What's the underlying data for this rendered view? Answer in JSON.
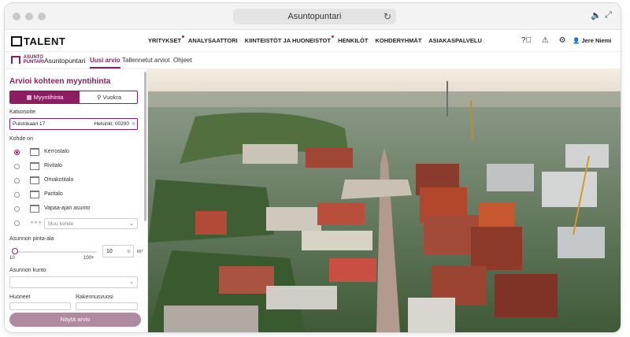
{
  "browser": {
    "url_title": "Asuntopuntari",
    "reload_icon": "reload-icon",
    "audio_icon": "speaker-icon",
    "expand_icon": "expand-icon"
  },
  "topnav": {
    "logo_text": "TALENT",
    "links": [
      "YRITYKSET",
      "ANALYSAATTORI",
      "KIINTEISTÖT JA HUONEISTOT",
      "HENKILÖT",
      "KOHDERYHMÄT",
      "ASIAKASPALVELU"
    ],
    "icons": [
      "help-icon",
      "warning-icon",
      "gear-icon",
      "user-icon"
    ],
    "user_name": "Jere Niemi"
  },
  "subnav": {
    "brand_line1": "ASUNTO",
    "brand_line2": "PUNTARI",
    "app_name": "Asuntopuntari",
    "tabs": [
      "Uusi arvio",
      "Tallennetut arviot",
      "Ohjeet"
    ],
    "active_tab": "Uusi arvio"
  },
  "form": {
    "title": "Arvioi kohteen myyntihinta",
    "toggle_sale": "Myyntihinta",
    "toggle_rent": "Vuokra",
    "address_label": "Katuosoite",
    "address_value": "Puistokaari 17",
    "address_city": "Helsinki, 00200",
    "type_label": "Kohde on",
    "types": [
      "Kerrostalo",
      "Rivitalo",
      "Omakotitalo",
      "Paritalo",
      "Vapaa-ajan asunto"
    ],
    "selected_type": "Kerrostalo",
    "other_type_placeholder": "Muu kohde",
    "area_label": "Asunnon pinta-ala",
    "area_min": "10",
    "area_max": "100+",
    "area_value": "10",
    "area_unit": "m²",
    "slider_level": 0,
    "condition_label": "Asunnon kunto",
    "rooms_label": "Huoneet",
    "year_label": "Rakennusvuosi",
    "submit_label": "Näytä arvio"
  },
  "colors": {
    "accent": "#8b1e61",
    "button_disabled": "#b08aa1"
  }
}
